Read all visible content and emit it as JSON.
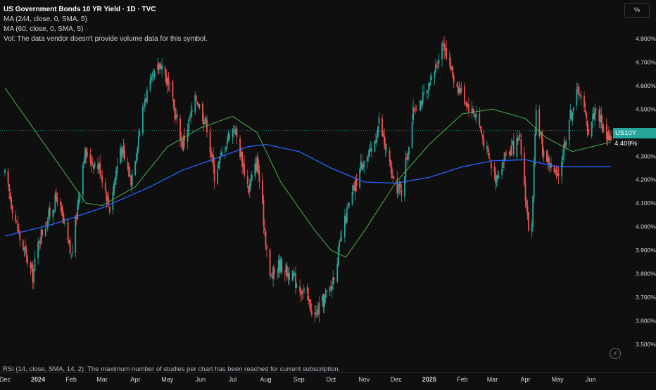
{
  "legend": {
    "title": "US Government Bonds 10 YR Yield · 1D · TVC",
    "ma1": "MA (244, close, 0, SMA, 5)",
    "ma2": "MA (60, close, 0, SMA, 5)",
    "vol": "Vol: The data vendor doesn't provide volume data for this symbol."
  },
  "unit_button": "%",
  "rsi_note": "RSI (14, close, SMA, 14, 2): The maximum number of studies per chart has been reached for current subscription.",
  "last_price": {
    "symbol": "US10Y",
    "value": "4.409%"
  },
  "colors": {
    "background": "#0f0f0f",
    "up": "#26a69a",
    "down": "#ef5350",
    "ma_244": "#2962ff",
    "ma_60": "#4caf50",
    "grid": "#1a1a1a",
    "axis_text": "#d1d4dc"
  },
  "icons": {
    "bolt": "lightning-bolt-icon"
  },
  "chart_data": {
    "type": "candlestick",
    "title": "US Government Bonds 10 YR Yield · 1D · TVC",
    "y_unit": "%",
    "ylim": [
      3.47,
      4.86
    ],
    "y_ticks": [
      "4.800%",
      "4.700%",
      "4.600%",
      "4.500%",
      "4.400%",
      "4.300%",
      "4.200%",
      "4.100%",
      "4.000%",
      "3.900%",
      "3.800%",
      "3.700%",
      "3.600%",
      "3.500%"
    ],
    "y_tick_values": [
      4.8,
      4.7,
      4.6,
      4.5,
      4.4,
      4.3,
      4.2,
      4.1,
      4.0,
      3.9,
      3.8,
      3.7,
      3.6,
      3.5
    ],
    "x_ticks": [
      {
        "label": "Dec",
        "date": "2023-12-01"
      },
      {
        "label": "2024",
        "date": "2024-01-01"
      },
      {
        "label": "Feb",
        "date": "2024-02-01"
      },
      {
        "label": "Mar",
        "date": "2024-03-01"
      },
      {
        "label": "Apr",
        "date": "2024-04-01"
      },
      {
        "label": "May",
        "date": "2024-05-01"
      },
      {
        "label": "Jun",
        "date": "2024-06-01"
      },
      {
        "label": "Jul",
        "date": "2024-07-01"
      },
      {
        "label": "Aug",
        "date": "2024-08-01"
      },
      {
        "label": "Sep",
        "date": "2024-09-01"
      },
      {
        "label": "Oct",
        "date": "2024-10-01"
      },
      {
        "label": "Nov",
        "date": "2024-11-01"
      },
      {
        "label": "Dec",
        "date": "2024-12-01"
      },
      {
        "label": "2025",
        "date": "2025-01-01"
      },
      {
        "label": "Feb",
        "date": "2025-02-01"
      },
      {
        "label": "Mar",
        "date": "2025-03-01"
      },
      {
        "label": "Apr",
        "date": "2025-04-01"
      },
      {
        "label": "May",
        "date": "2025-05-01"
      },
      {
        "label": "Jun",
        "date": "2025-06-01"
      }
    ],
    "x_range": [
      "2023-12-01",
      "2025-06-20"
    ],
    "close_path": [
      [
        "2023-12-01",
        4.22
      ],
      [
        "2023-12-15",
        3.95
      ],
      [
        "2023-12-27",
        3.79
      ],
      [
        "2024-01-02",
        3.95
      ],
      [
        "2024-01-19",
        4.13
      ],
      [
        "2024-02-01",
        3.87
      ],
      [
        "2024-02-13",
        4.31
      ],
      [
        "2024-02-28",
        4.25
      ],
      [
        "2024-03-08",
        4.08
      ],
      [
        "2024-03-18",
        4.34
      ],
      [
        "2024-03-28",
        4.2
      ],
      [
        "2024-04-10",
        4.55
      ],
      [
        "2024-04-25",
        4.7
      ],
      [
        "2024-05-02",
        4.6
      ],
      [
        "2024-05-15",
        4.35
      ],
      [
        "2024-05-28",
        4.55
      ],
      [
        "2024-06-07",
        4.43
      ],
      [
        "2024-06-14",
        4.22
      ],
      [
        "2024-06-28",
        4.4
      ],
      [
        "2024-07-03",
        4.42
      ],
      [
        "2024-07-16",
        4.16
      ],
      [
        "2024-07-24",
        4.28
      ],
      [
        "2024-08-05",
        3.78
      ],
      [
        "2024-08-14",
        3.84
      ],
      [
        "2024-08-23",
        3.8
      ],
      [
        "2024-09-06",
        3.72
      ],
      [
        "2024-09-16",
        3.62
      ],
      [
        "2024-10-01",
        3.74
      ],
      [
        "2024-10-15",
        4.04
      ],
      [
        "2024-10-31",
        4.29
      ],
      [
        "2024-11-08",
        4.31
      ],
      [
        "2024-11-15",
        4.45
      ],
      [
        "2024-11-29",
        4.18
      ],
      [
        "2024-12-06",
        4.15
      ],
      [
        "2024-12-18",
        4.51
      ],
      [
        "2024-12-31",
        4.57
      ],
      [
        "2025-01-14",
        4.79
      ],
      [
        "2025-01-24",
        4.63
      ],
      [
        "2025-02-10",
        4.49
      ],
      [
        "2025-02-14",
        4.48
      ],
      [
        "2025-02-25",
        4.3
      ],
      [
        "2025-03-04",
        4.21
      ],
      [
        "2025-03-14",
        4.31
      ],
      [
        "2025-03-27",
        4.36
      ],
      [
        "2025-04-04",
        4.0
      ],
      [
        "2025-04-07",
        3.99
      ],
      [
        "2025-04-11",
        4.49
      ],
      [
        "2025-04-17",
        4.33
      ],
      [
        "2025-05-01",
        4.2
      ],
      [
        "2025-05-12",
        4.46
      ],
      [
        "2025-05-21",
        4.59
      ],
      [
        "2025-05-30",
        4.41
      ],
      [
        "2025-06-06",
        4.51
      ],
      [
        "2025-06-13",
        4.41
      ],
      [
        "2025-06-20",
        4.38
      ]
    ],
    "series": [
      {
        "name": "MA (244, close, 0, SMA, 5)",
        "color": "#2962ff",
        "points": [
          [
            "2023-12-01",
            3.96
          ],
          [
            "2024-01-15",
            4.01
          ],
          [
            "2024-03-01",
            4.08
          ],
          [
            "2024-04-15",
            4.17
          ],
          [
            "2024-05-15",
            4.24
          ],
          [
            "2024-06-15",
            4.29
          ],
          [
            "2024-07-15",
            4.34
          ],
          [
            "2024-08-01",
            4.35
          ],
          [
            "2024-09-01",
            4.32
          ],
          [
            "2024-10-01",
            4.25
          ],
          [
            "2024-11-01",
            4.19
          ],
          [
            "2024-12-01",
            4.185
          ],
          [
            "2025-01-01",
            4.21
          ],
          [
            "2025-02-01",
            4.255
          ],
          [
            "2025-03-01",
            4.28
          ],
          [
            "2025-04-01",
            4.285
          ],
          [
            "2025-05-01",
            4.255
          ],
          [
            "2025-06-20",
            4.255
          ]
        ]
      },
      {
        "name": "MA (60, close, 0, SMA, 5)",
        "color": "#4caf50",
        "points": [
          [
            "2023-12-01",
            4.59
          ],
          [
            "2024-01-15",
            4.3
          ],
          [
            "2024-02-15",
            4.1
          ],
          [
            "2024-03-01",
            4.09
          ],
          [
            "2024-04-01",
            4.17
          ],
          [
            "2024-05-01",
            4.34
          ],
          [
            "2024-06-01",
            4.42
          ],
          [
            "2024-07-01",
            4.47
          ],
          [
            "2024-07-24",
            4.4
          ],
          [
            "2024-08-15",
            4.19
          ],
          [
            "2024-09-15",
            3.99
          ],
          [
            "2024-10-01",
            3.9
          ],
          [
            "2024-10-15",
            3.87
          ],
          [
            "2024-11-01",
            3.98
          ],
          [
            "2024-12-01",
            4.19
          ],
          [
            "2025-01-01",
            4.35
          ],
          [
            "2025-02-01",
            4.48
          ],
          [
            "2025-03-01",
            4.5
          ],
          [
            "2025-04-01",
            4.46
          ],
          [
            "2025-04-20",
            4.38
          ],
          [
            "2025-05-15",
            4.32
          ],
          [
            "2025-06-20",
            4.36
          ]
        ]
      }
    ],
    "last_value": 4.409,
    "grid": false
  }
}
